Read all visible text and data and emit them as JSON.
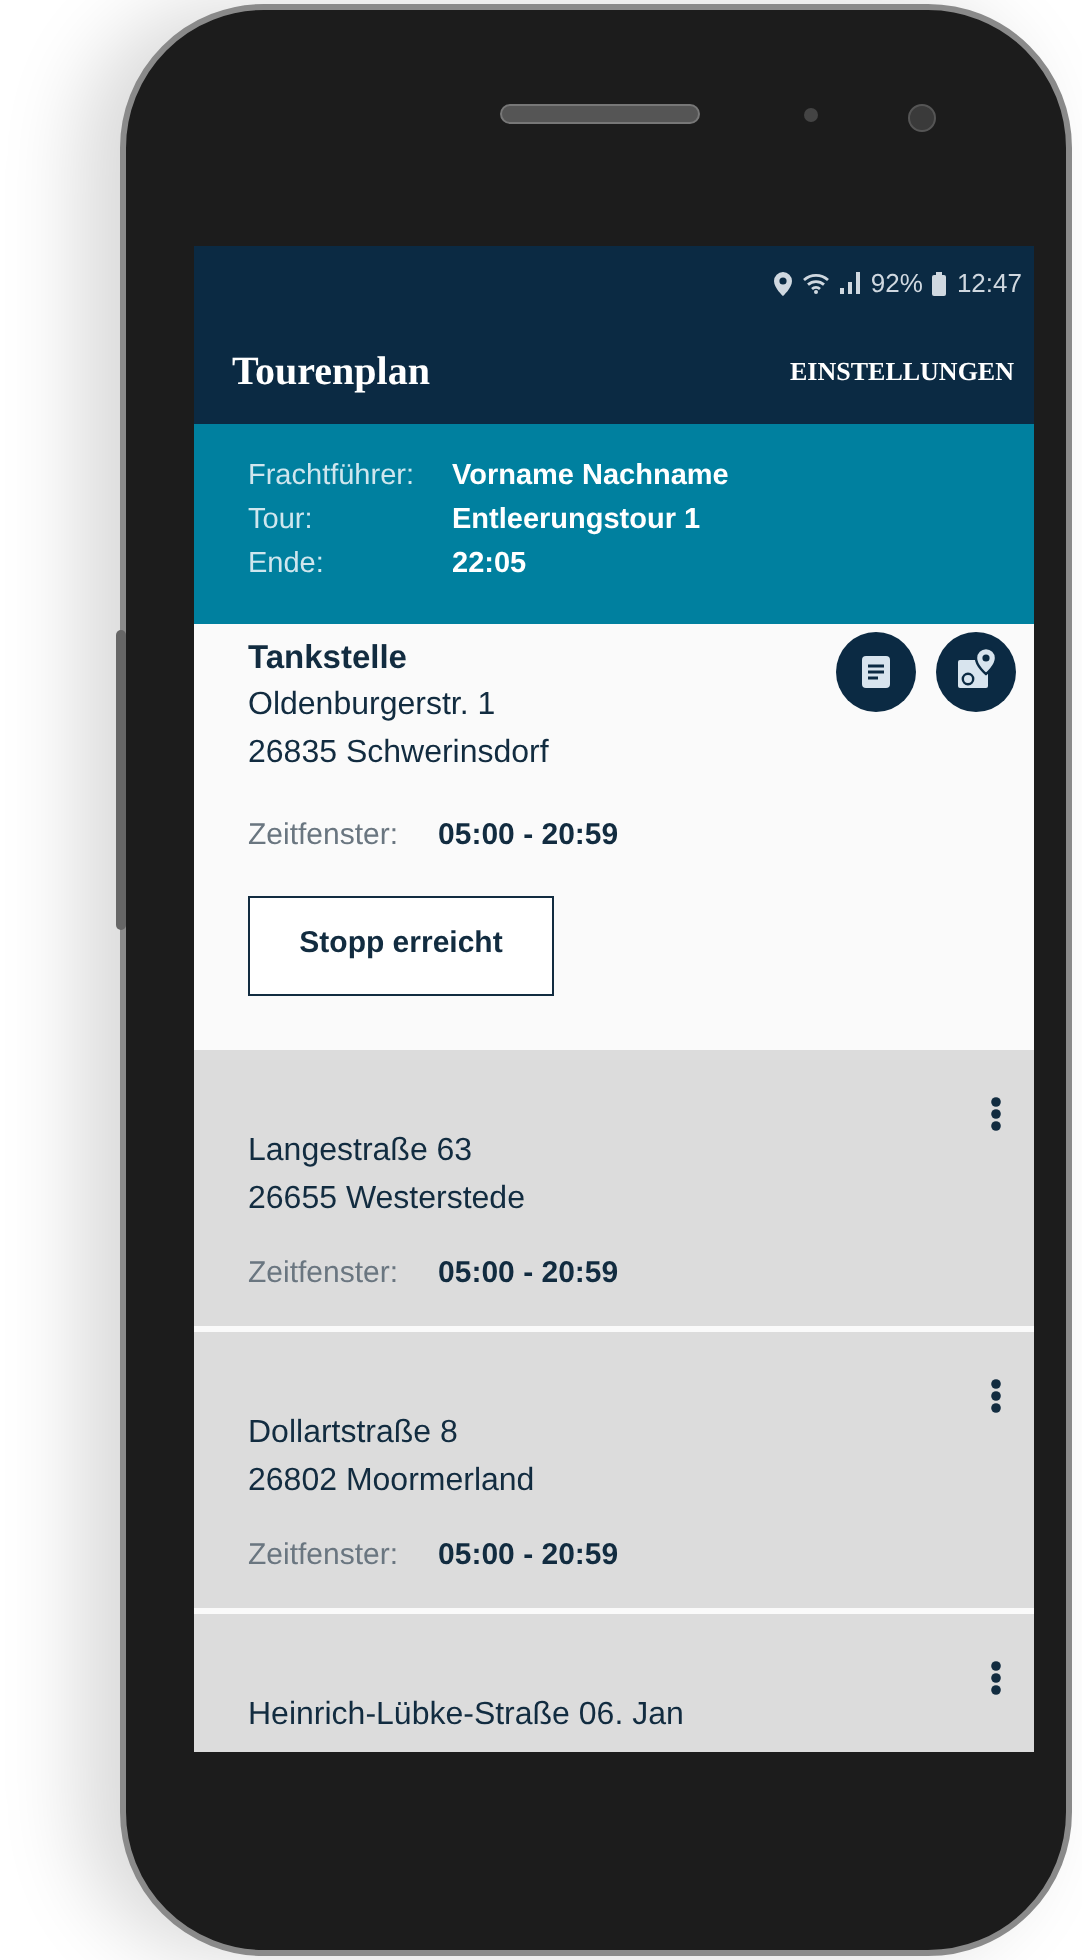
{
  "status_bar": {
    "battery": "92%",
    "time": "12:47"
  },
  "app_bar": {
    "title": "Tourenplan",
    "action": "EINSTELLUNGEN"
  },
  "tour_info": [
    {
      "label": "Frachtführer:",
      "value": "Vorname Nachname"
    },
    {
      "label": "Tour:",
      "value": "Entleerungstour 1"
    },
    {
      "label": "Ende:",
      "value": "22:05"
    }
  ],
  "stops": [
    {
      "kind": "current",
      "name": "Tankstelle",
      "address": [
        "Oldenburgerstr. 1",
        "26835 Schwerinsdorf"
      ],
      "window_label": "Zeitfenster:",
      "window": "05:00 - 20:59",
      "button": "Stopp erreicht"
    },
    {
      "kind": "pending",
      "address": [
        "Langestraße 63",
        "26655 Westerstede"
      ],
      "window_label": "Zeitfenster:",
      "window": "05:00 - 20:59"
    },
    {
      "kind": "pending",
      "address": [
        "Dollartstraße 8",
        "26802 Moormerland"
      ],
      "window_label": "Zeitfenster:",
      "window": "05:00 - 20:59"
    },
    {
      "kind": "pending",
      "address": [
        "Heinrich-Lübke-Straße 06. Jan"
      ]
    }
  ]
}
